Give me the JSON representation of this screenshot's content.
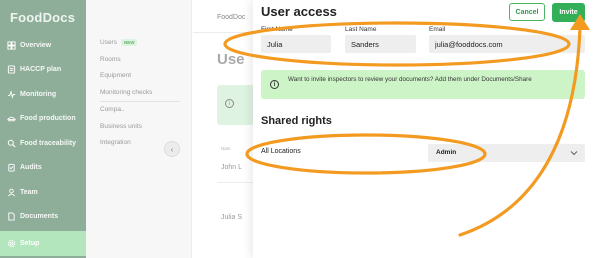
{
  "app": {
    "logo_text": "FoodDocs"
  },
  "sidebar": {
    "items": [
      {
        "label": "Overview",
        "icon": "overview-icon"
      },
      {
        "label": "HACCP plan",
        "icon": "haccp-plan-icon"
      },
      {
        "label": "Monitoring",
        "icon": "monitoring-icon"
      },
      {
        "label": "Food production",
        "icon": "food-production-icon"
      },
      {
        "label": "Food traceability",
        "icon": "search-icon"
      },
      {
        "label": "Audits",
        "icon": "audits-icon"
      },
      {
        "label": "Team",
        "icon": "team-icon"
      },
      {
        "label": "Documents",
        "icon": "documents-icon"
      },
      {
        "label": "Setup",
        "icon": "gear-icon",
        "active": true
      }
    ]
  },
  "subnav": {
    "items": [
      {
        "label": "Users",
        "badge": "NEW"
      },
      {
        "label": "Rooms"
      },
      {
        "label": "Equipment"
      },
      {
        "label": "Monitoring checks"
      },
      {
        "label": "Compa.."
      },
      {
        "label": "Business units"
      },
      {
        "label": "Integration"
      }
    ]
  },
  "background_page": {
    "brand_partial": "FoodDoc",
    "title_partial": "Use",
    "column_header_partial": "Nam",
    "row1_partial": "John L",
    "row2_partial": "Julia S"
  },
  "modal": {
    "title": "User access",
    "cancel_label": "Cancel",
    "invite_label": "Invite",
    "fields": {
      "first_name": {
        "label": "First Name",
        "value": "Julia"
      },
      "last_name": {
        "label": "Last Name",
        "value": "Sanders"
      },
      "email": {
        "label": "Email",
        "value": "julia@fooddocs.com"
      }
    },
    "info_banner": {
      "text": "Want to invite inspectors to review your documents? Add them under Documents/Share"
    },
    "shared_rights": {
      "title": "Shared rights",
      "location_label": "All Locations",
      "role_value": "Admin"
    }
  },
  "annotation": {
    "color": "#f39a21"
  }
}
